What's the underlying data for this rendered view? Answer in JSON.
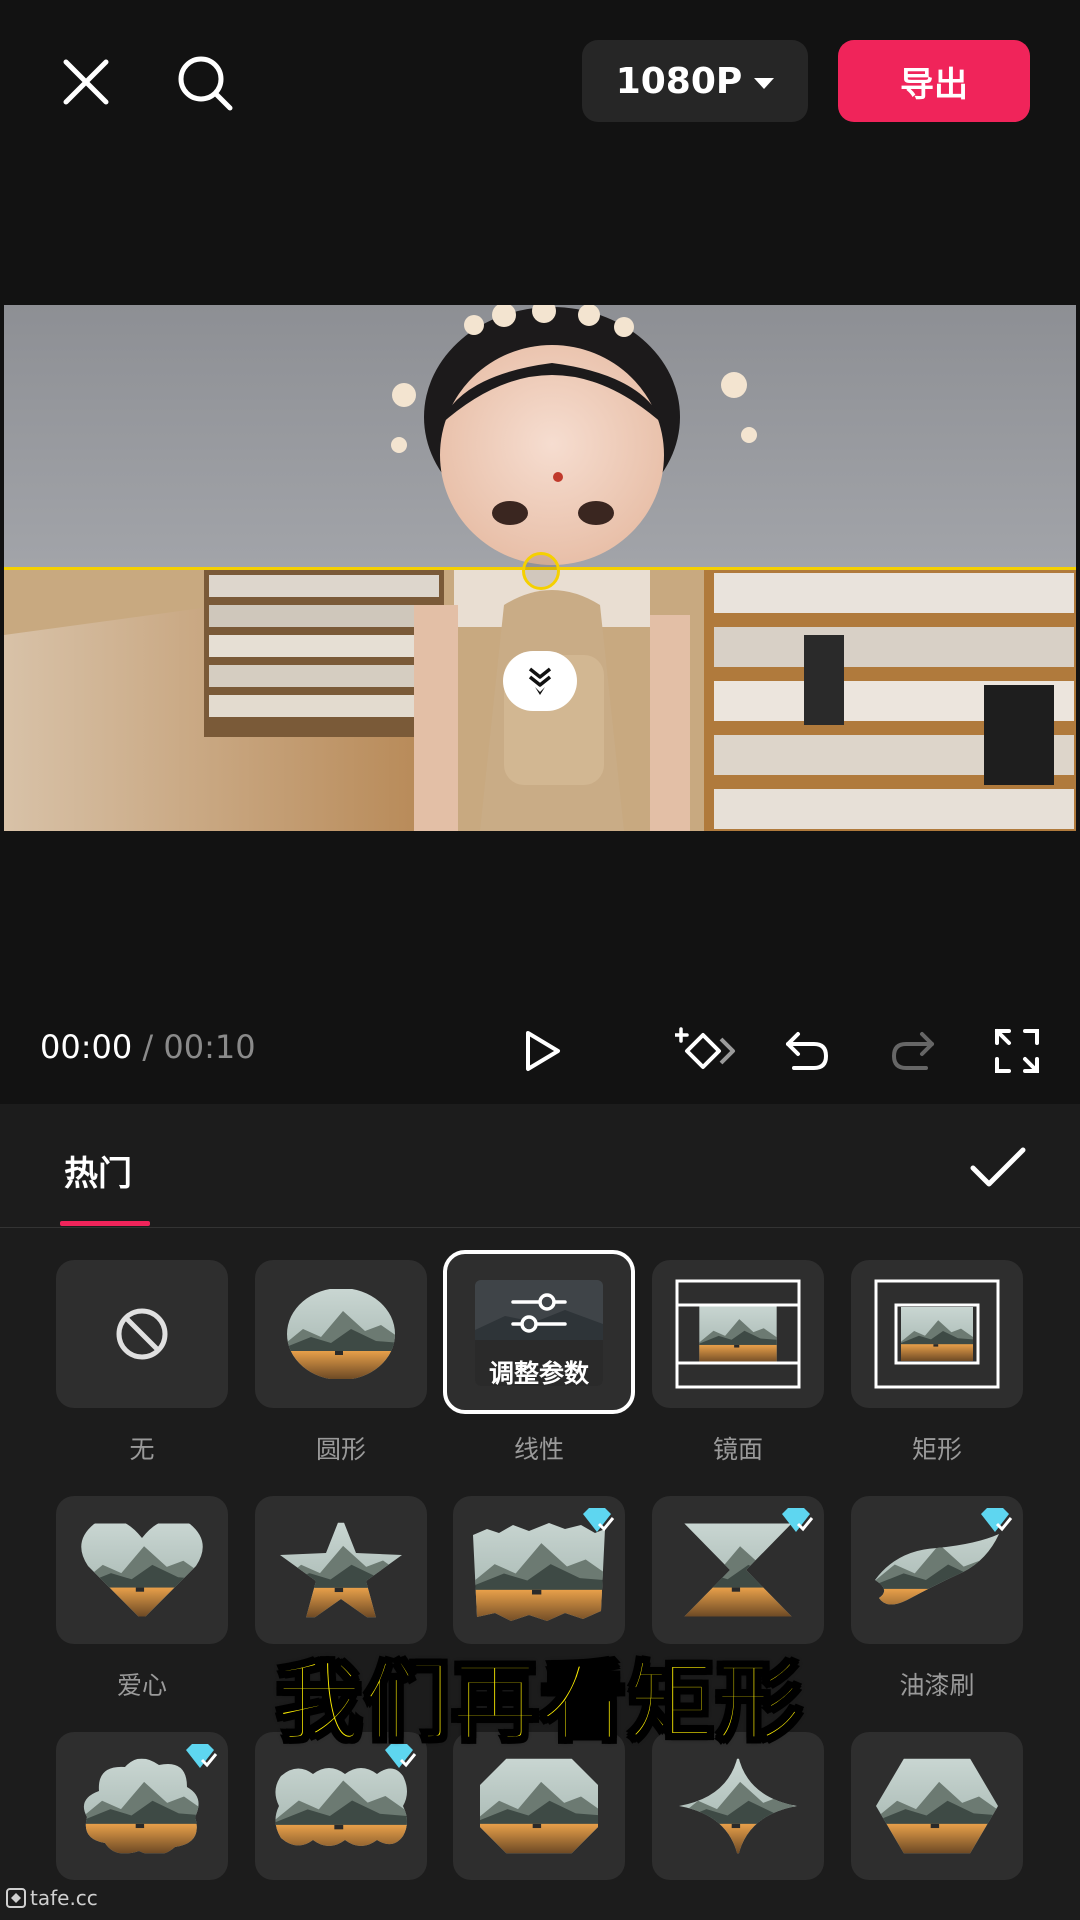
{
  "topbar": {
    "resolution_label": "1080P",
    "export_label": "导出"
  },
  "playback": {
    "current_time": "00:00",
    "separator": "/",
    "total_time": "00:10"
  },
  "panel": {
    "active_tab": "热门",
    "adjust_label": "调整参数",
    "masks": [
      {
        "label": "无",
        "icon": "none-icon"
      },
      {
        "label": "圆形",
        "icon": "circle-mask-icon"
      },
      {
        "label": "线性",
        "icon": "linear-mask-icon",
        "selected": true
      },
      {
        "label": "镜面",
        "icon": "mirror-mask-icon"
      },
      {
        "label": "矩形",
        "icon": "rectangle-mask-icon"
      },
      {
        "label": "爱心",
        "icon": "heart-mask-icon"
      },
      {
        "label": "",
        "icon": "star-mask-icon"
      },
      {
        "label": "",
        "icon": "torn-paper-mask-icon",
        "vip": true
      },
      {
        "label": "",
        "icon": "hourglass-mask-icon",
        "vip": true
      },
      {
        "label": "油漆刷",
        "icon": "paint-brush-mask-icon",
        "vip": true
      },
      {
        "label": "",
        "icon": "cloud-mask-icon",
        "vip": true
      },
      {
        "label": "",
        "icon": "wavy-mask-icon",
        "vip": true
      },
      {
        "label": "",
        "icon": "octagon-mask-icon"
      },
      {
        "label": "",
        "icon": "four-point-star-mask-icon"
      },
      {
        "label": "",
        "icon": "hexagon-mask-icon"
      }
    ]
  },
  "subtitle": "我们再看矩形",
  "watermark": "tafe.cc",
  "colors": {
    "accent": "#f0245a",
    "mask_line": "#f5d000",
    "subtitle": "#fff000",
    "vip": "#5ed6f0"
  }
}
